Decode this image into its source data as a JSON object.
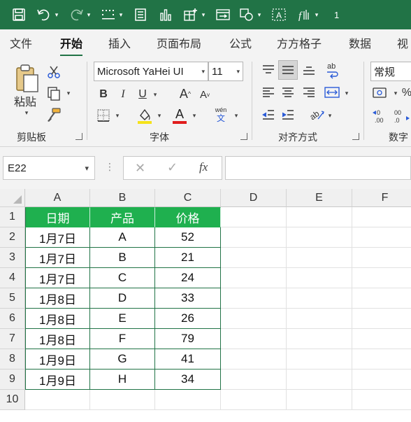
{
  "qat": {
    "trailing_text": "1"
  },
  "tabs": [
    "文件",
    "开始",
    "插入",
    "页面布局",
    "公式",
    "方方格子",
    "数据",
    "视"
  ],
  "active_tab": "开始",
  "ribbon": {
    "clipboard": {
      "paste_label": "粘贴",
      "group_label": "剪贴板"
    },
    "font": {
      "font_name": "Microsoft YaHei UI",
      "font_size": "11",
      "group_label": "字体",
      "bold": "B",
      "italic": "I",
      "underline": "U",
      "grow": "A",
      "shrink": "A",
      "font_color_letter": "A",
      "phonetic_top": "wén",
      "phonetic_bottom": "文"
    },
    "alignment": {
      "group_label": "对齐方式"
    },
    "number": {
      "format": "常规",
      "group_label": "数字"
    }
  },
  "formula_bar": {
    "name_box": "E22",
    "formula": ""
  },
  "grid": {
    "columns": [
      "A",
      "B",
      "C",
      "D",
      "E",
      "F"
    ],
    "rows": [
      "1",
      "2",
      "3",
      "4",
      "5",
      "6",
      "7",
      "8",
      "9",
      "10"
    ],
    "table": {
      "headers": [
        "日期",
        "产品",
        "价格"
      ],
      "rows": [
        [
          "1月7日",
          "A",
          "52"
        ],
        [
          "1月7日",
          "B",
          "21"
        ],
        [
          "1月7日",
          "C",
          "24"
        ],
        [
          "1月8日",
          "D",
          "33"
        ],
        [
          "1月8日",
          "E",
          "26"
        ],
        [
          "1月8日",
          "F",
          "79"
        ],
        [
          "1月9日",
          "G",
          "41"
        ],
        [
          "1月9日",
          "H",
          "34"
        ]
      ]
    }
  },
  "colors": {
    "brand": "#217346",
    "table_header": "#1fb04f",
    "font_color_bar": "#e01d1d",
    "highlight_bar": "#f5e31a"
  }
}
